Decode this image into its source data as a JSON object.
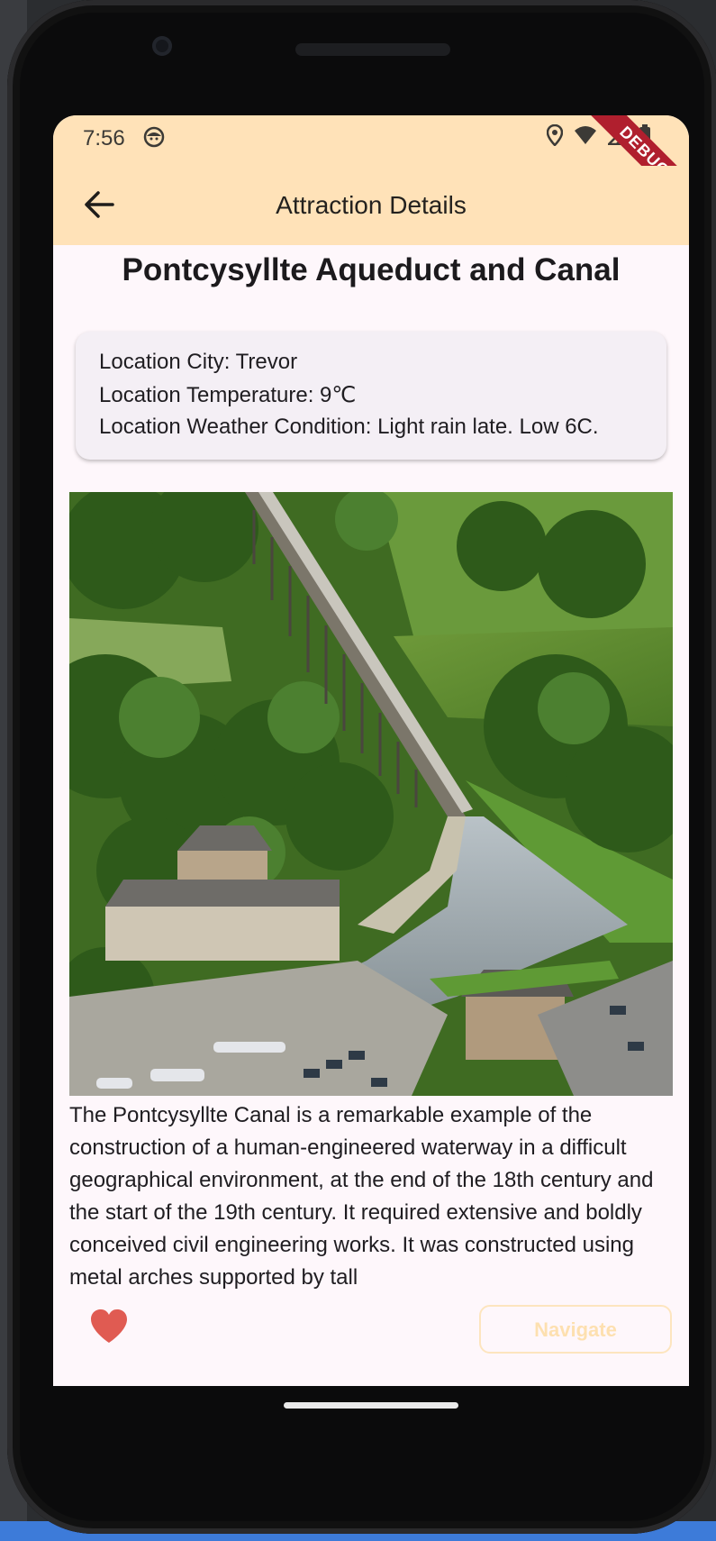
{
  "status_bar": {
    "time": "7:56",
    "debug_label": "DEBUG"
  },
  "app_bar": {
    "title": "Attraction Details",
    "back_icon": "arrow-left-icon"
  },
  "attraction": {
    "name": "Pontcysyllte Aqueduct and Canal",
    "info": {
      "city": "Location City: Trevor",
      "temperature": "Location Temperature: 9℃",
      "weather": "Location Weather Condition: Light rain late. Low 6C."
    },
    "description": "The Pontcysyllte Canal is a remarkable example of the construction of a human-engineered waterway in a difficult geographical environment, at the end of the 18th century and the start of the 19th century. It required extensive and boldly conceived civil engineering works. It was constructed using metal arches supported by tall"
  },
  "actions": {
    "favorite_icon": "heart-icon",
    "favorite_color": "#e05b52",
    "navigate_label": "Navigate"
  },
  "colors": {
    "app_bar_bg": "#ffe2b8",
    "screen_bg": "#fef7fb",
    "card_bg": "#f4eff5"
  }
}
